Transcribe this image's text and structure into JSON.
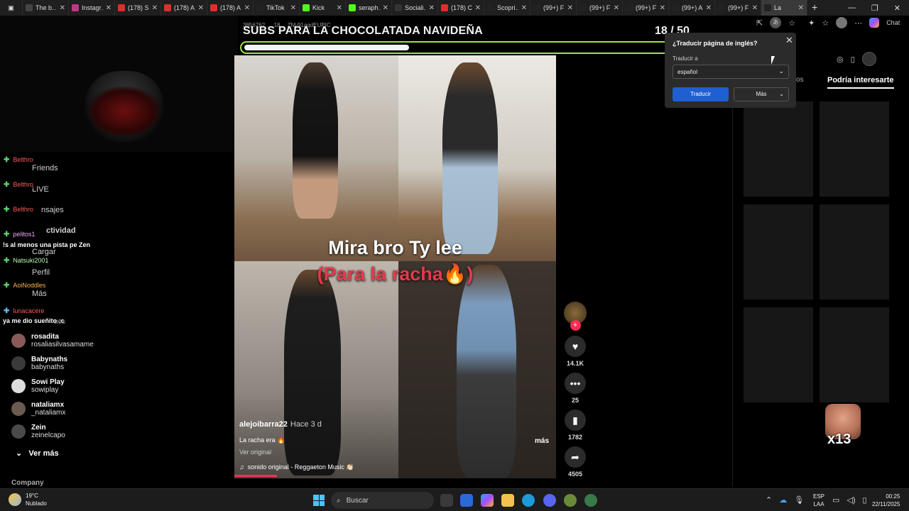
{
  "browser": {
    "tabs": [
      {
        "title": "The b…",
        "color": "#444"
      },
      {
        "title": "Instagr…",
        "color": "#c13584"
      },
      {
        "title": "(178) S…",
        "color": "#e02d2d"
      },
      {
        "title": "(178) A…",
        "color": "#e02d2d"
      },
      {
        "title": "(178) A…",
        "color": "#e02d2d"
      },
      {
        "title": "TikTok",
        "color": "#222"
      },
      {
        "title": "Kick",
        "color": "#53fc18"
      },
      {
        "title": "seraph…",
        "color": "#53fc18"
      },
      {
        "title": "Sociali…",
        "color": "#333"
      },
      {
        "title": "(178) C…",
        "color": "#e02d2d"
      },
      {
        "title": "Scopri…",
        "color": "#222"
      },
      {
        "title": "(99+) F…",
        "color": "#222"
      },
      {
        "title": "(99+) F…",
        "color": "#222"
      },
      {
        "title": "(99+) F…",
        "color": "#222"
      },
      {
        "title": "(99+) A…",
        "color": "#222"
      },
      {
        "title": "(99+) F…",
        "color": "#222"
      },
      {
        "title": "La",
        "color": "#222"
      }
    ],
    "url_fragment": "3856762 … 18… ZM-91aqdEUPIC",
    "copilot_label": "Chat"
  },
  "stream_overlay": {
    "goal_title": "SUBS PARA LA CHOCOLATADA NAVIDEÑA",
    "goal_count": "18  / 50",
    "progress": 0.36,
    "bar_color": "#9fe04a"
  },
  "sidebar": {
    "nav": [
      "Friends",
      "LIVE",
      "nsajes",
      "ctividad",
      "Cargar",
      "Perfil",
      "Más"
    ],
    "chat": [
      {
        "name": "Belthro",
        "color": "#ff5a5a"
      },
      {
        "name": "Belthro",
        "color": "#ff5a5a"
      },
      {
        "name": "Belthro",
        "color": "#ff5a5a"
      },
      {
        "name": "pelitos1",
        "color": "#f4a6ff"
      },
      {
        "name": "Natsuki2001",
        "color": "#b8ffb0"
      },
      {
        "name": "AoiNoddles",
        "color": "#ffb347"
      },
      {
        "name": "lunacacere",
        "color": "#ff5a5a"
      }
    ],
    "chat_messages": [
      "!s al menos una pista pe Zen",
      "ya me dio sueñito :c"
    ],
    "following_header": "ues",
    "following": [
      {
        "display": "rosadita",
        "user": "rosaliasilvasamame"
      },
      {
        "display": "Babynaths",
        "user": "babynaths"
      },
      {
        "display": "Sowi Play",
        "user": "sowiplay"
      },
      {
        "display": "nataliamx",
        "user": "_nataliamx"
      },
      {
        "display": "Zein",
        "user": "zeinelcapo"
      }
    ],
    "see_more": "Ver más",
    "company": "Company"
  },
  "video": {
    "caption_line1": "Mira bro Ty lee",
    "caption_line2": "(Para la racha🔥)",
    "author": "alejoibarra22",
    "ago": "Hace 3 d",
    "description": "La racha era 🔥",
    "see_original": "Ver original",
    "sound": "sonido original - Reggaeton Music 👏🏻",
    "more": "más"
  },
  "actions": {
    "likes": "14.1K",
    "comments": "25",
    "saves": "1782",
    "shares": "4505"
  },
  "translate_popup": {
    "title": "¿Traducir página de inglés?",
    "label": "Traducir a",
    "selected": "español",
    "primary": "Traducir",
    "secondary": "Más"
  },
  "right_panel": {
    "tab_partial": "os",
    "tab_active": "Podría interesarte",
    "emote_count": "x13"
  },
  "taskbar": {
    "temp": "19°C",
    "weather": "Nublado",
    "search": "Buscar",
    "lang1": "ESP",
    "lang2": "LAA",
    "time": "00:25",
    "date": "22/11/2025"
  }
}
